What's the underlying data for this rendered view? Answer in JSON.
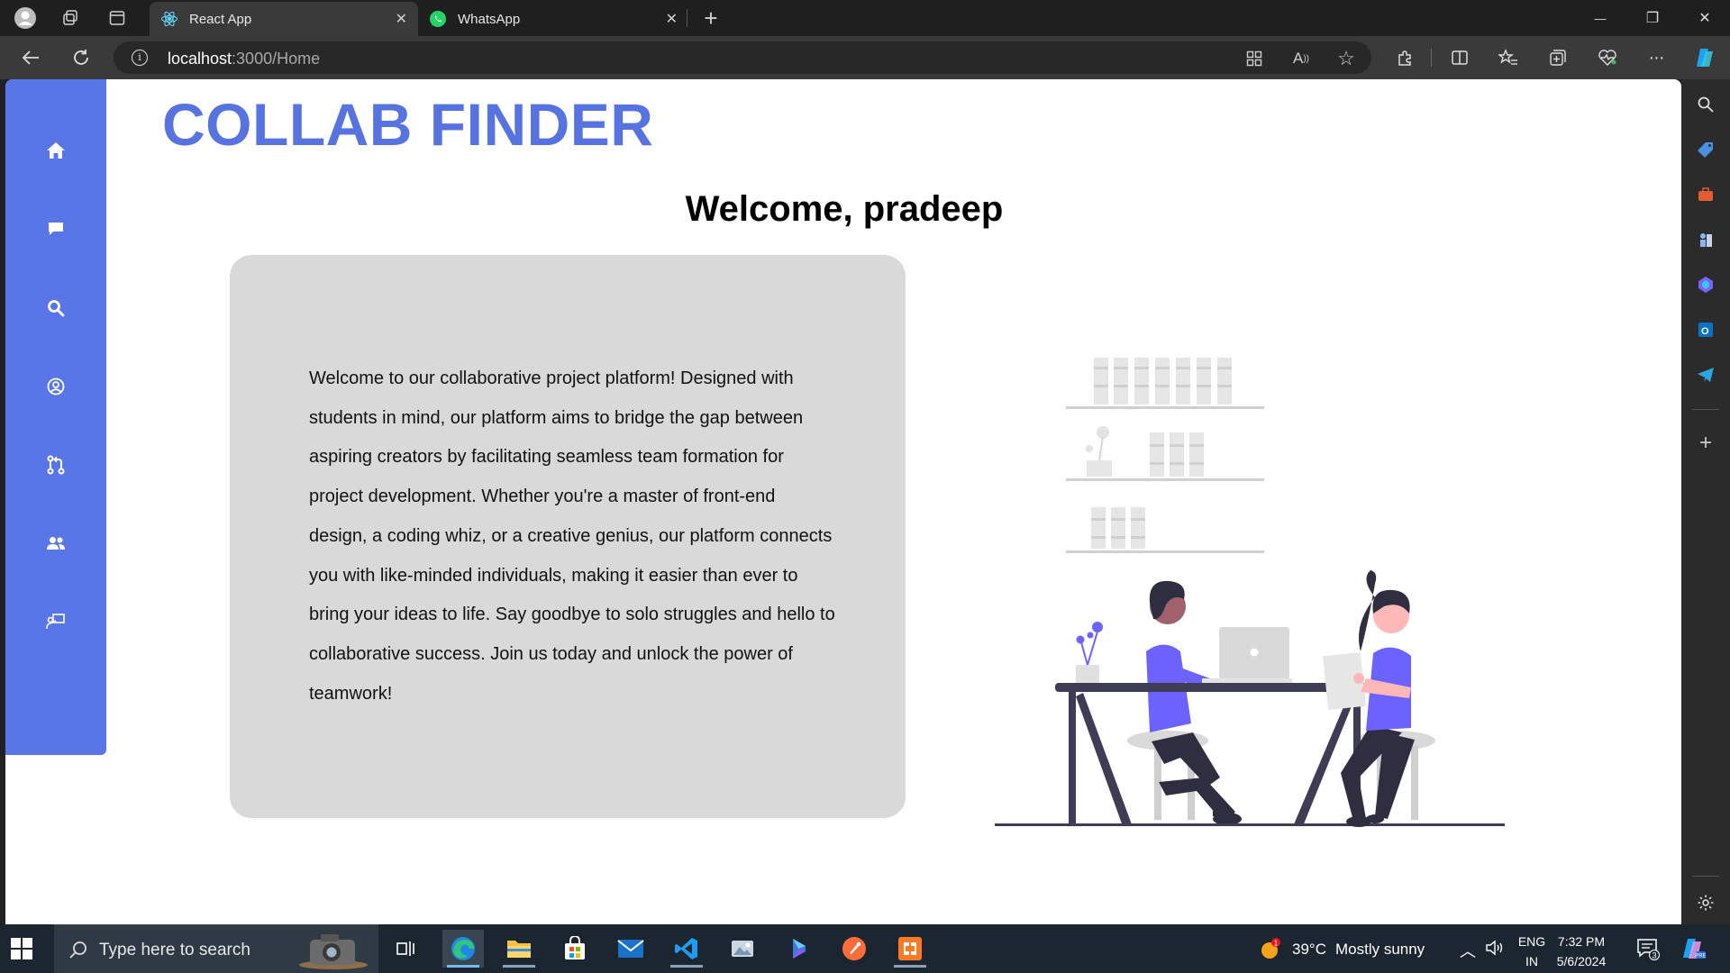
{
  "browser": {
    "tabs": [
      {
        "title": "React App",
        "active": true
      },
      {
        "title": "WhatsApp",
        "active": false
      }
    ],
    "url_host": "localhost",
    "url_rest": ":3000/Home",
    "new_tab_glyph": "+",
    "close_glyph": "✕",
    "window_controls": {
      "minimize": "—",
      "restore": "❐",
      "close": "✕"
    },
    "more_glyph": "···",
    "icons": [
      "profile-avatar-icon",
      "workspaces-icon",
      "vertical-tabs-icon",
      "back-arrow-icon",
      "refresh-icon",
      "site-info-icon",
      "app-available-icon",
      "read-aloud-icon",
      "favorite-star-icon",
      "extensions-icon",
      "split-screen-icon",
      "favorites-icon",
      "collections-icon",
      "browser-essentials-icon",
      "settings-more-icon",
      "copilot-icon"
    ]
  },
  "edge_sidebar": {
    "icons": [
      "search-icon",
      "shopping-tag-icon",
      "tools-briefcase-icon",
      "games-chess-icon",
      "copilot-icon",
      "outlook-icon",
      "telegram-send-icon",
      "add-icon",
      "sidebar-settings-icon"
    ],
    "plus_glyph": "+"
  },
  "app": {
    "brand": "COLLAB FINDER",
    "welcome": "Welcome, pradeep",
    "intro": "Welcome to our collaborative project platform! Designed with students in mind, our platform aims to bridge the gap between aspiring creators by facilitating seamless team formation for project development. Whether you're a master of front-end design, a coding whiz, or a creative genius, our platform connects you with like-minded individuals, making it easier than ever to bring your ideas to life. Say goodbye to solo struggles and hello to collaborative success. Join us today and unlock the power of teamwork!",
    "nav_icons": [
      "home-icon",
      "chat-icon",
      "search-icon",
      "user-profile-icon",
      "pull-request-icon",
      "team-icon",
      "presentation-icon"
    ],
    "colors": {
      "primary": "#5876e5",
      "brand_text": "#5773e0",
      "card_bg": "#d9d9d9",
      "illustration_accent": "#6c63ff"
    }
  },
  "taskbar": {
    "search_placeholder": "Type here to search",
    "weather_temp": "39°C",
    "weather_desc": "Mostly sunny",
    "weather_badge": "1",
    "language_1": "ENG",
    "language_2": "IN",
    "time": "7:32 PM",
    "date": "5/6/2024",
    "notification_count": "3",
    "apps": [
      "task-view-icon",
      "edge-icon",
      "file-explorer-icon",
      "microsoft-store-icon",
      "mail-icon",
      "vscode-icon",
      "photos-icon",
      "copilot-icon",
      "postman-icon",
      "xampp-icon"
    ]
  }
}
